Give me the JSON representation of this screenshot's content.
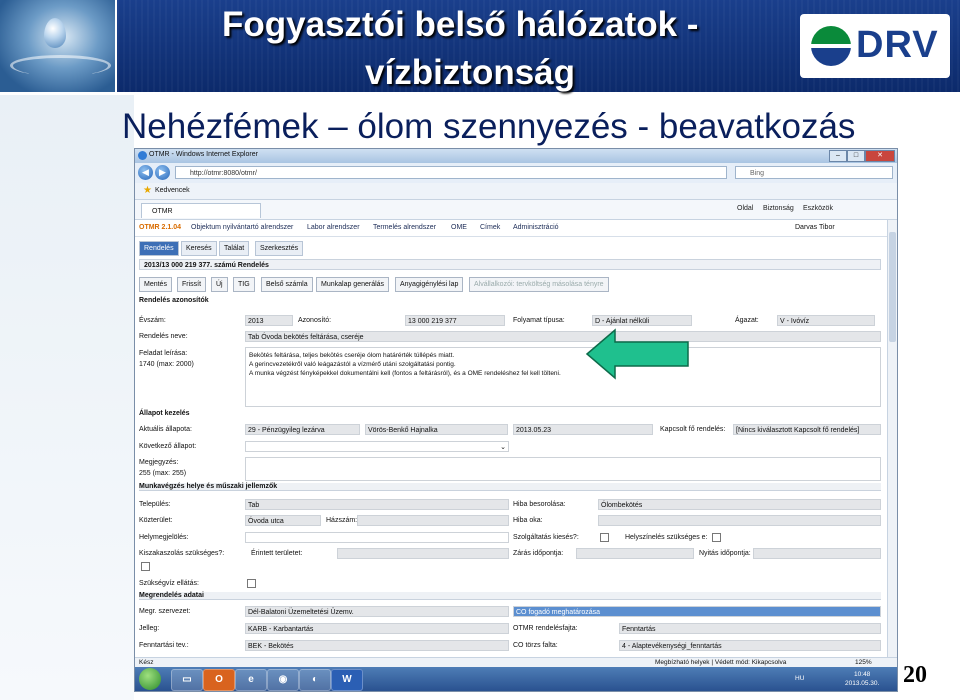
{
  "slide": {
    "title_line1": "Fogyasztói belső hálózatok -",
    "title_line2": "vízbiztonság",
    "subtitle": "Nehézfémek – ólom szennyezés - beavatkozás",
    "logo_text": "DRV",
    "page_number": "20",
    "colors": {
      "title_bg": "#0c2a6b",
      "logo_blue": "#1a3f8c",
      "logo_green": "#0a8a3a",
      "arrow_green": "#1fc08e"
    }
  },
  "browser": {
    "window_title": "OTMR - Windows Internet Explorer",
    "address": "http://otmr:8080/otmr/",
    "search_placeholder": "Bing",
    "favorites_label": "Kedvencek",
    "tab_label": "OTMR",
    "commands": [
      "Oldal",
      "Biztonság",
      "Eszközök"
    ],
    "status_left": "Kész",
    "status_mid": "Megbízható helyek | Védett mód: Kikapcsolva",
    "zoom": "125%"
  },
  "app": {
    "version": "OTMR 2.1.04",
    "menu": [
      "Objektum nyilvántartó alrendszer",
      "Labor alrendszer",
      "Termelés alrendszer",
      "OME",
      "Címek",
      "Adminisztráció"
    ],
    "user": "Darvas Tibor",
    "subtabs": [
      "Rendelés",
      "Keresés",
      "Találat",
      "Szerkesztés"
    ],
    "breadcrumb": "2013/13 000 219 377. számú Rendelés",
    "toolbar": [
      "Mentés",
      "Frissít",
      "Új",
      "TIG",
      "Belső számla",
      "Munkalap generálás",
      "Anyagigénylési lap",
      "Alvállalkozói: tervköltség másolása tényre"
    ],
    "sec_ids": "Rendelés azonosítók",
    "evszam_label": "Évszám:",
    "evszam": "2013",
    "azonosito_label": "Azonosító:",
    "azonosito": "13 000 219 377",
    "folyamat_label": "Folyamat típusa:",
    "folyamat": "D - Ajánlat nélküli",
    "agazat_label": "Ágazat:",
    "agazat": "V - Ivóvíz",
    "rendeles_neve_label": "Rendelés neve:",
    "rendeles_neve": "Tab Óvoda bekötés feltárása, cseréje",
    "feladat_label": "Feladat leírása:",
    "feladat_max": "1740 (max: 2000)",
    "feladat_text": [
      "Bekötés feltárása, teljes bekötés cseréje ólom határérték túllépés miatt.",
      "A gerincvezetékről való leágazástól a vízmérő utáni szolgáltatási pontig.",
      "A munka végzést fényképekkel dokumentálni kell (fontos a feltárásról), és a OME rendeléshez fel kell tölteni."
    ],
    "sec_allapot": "Állapot kezelés",
    "aktualis_label": "Aktuális állapota:",
    "aktualis": "29 - Pénzügyileg lezárva",
    "szemely": "Vörös-Benkő Hajnalka",
    "datum": "2013.05.23",
    "kapcsolt_label": "Kapcsolt fő rendelés:",
    "kapcsolt": "[Nincs kiválasztott Kapcsolt fő rendelés]",
    "kovetkezo_label": "Következő állapot:",
    "megjegyzes_label": "Megjegyzés:",
    "megjegyzes_max": "255 (max: 255)",
    "sec_munka": "Munkavégzés helye és műszaki jellemzők",
    "telepules_label": "Település:",
    "telepules": "Tab",
    "hiba_besorolas_label": "Hiba besorolása:",
    "hiba_besorolas": "Ólombekötés",
    "kozterulet_label": "Közterület:",
    "kozterulet": "Óvoda utca",
    "hazszam_label": "Házszám:",
    "hiba_oka_label": "Hiba oka:",
    "helymegjeloles_label": "Helymegjelölés:",
    "szolgaltatas_label": "Szolgáltatás kiesés?:",
    "helyszinelés_label": "Helyszínelés szükséges e:",
    "kiszakaszolas_label": "Kiszakaszolás szükséges?:",
    "erintett_label": "Érintett területet:",
    "zaras_label": "Zárás időpontja:",
    "nyitas_label": "Nyitás időpontja:",
    "szuksegviz_label": "Szükségvíz ellátás:",
    "sec_megrendeles": "Megrendelés adatai",
    "megr_szervezet_label": "Megr. szervezet:",
    "megr_szervezet": "Dél-Balatoni Üzemeltetési Üzemv.",
    "co_fogado": "CO fogadó meghatározása",
    "jelleg_label": "Jelleg:",
    "jelleg": "KARB - Karbantartás",
    "otmr_fajta_label": "OTMR rendelésfajta:",
    "otmr_fajta": "Fenntartás",
    "fenntartasi_label": "Fenntartási tev.:",
    "fenntartasi": "BEK - Bekötés",
    "co_torzs_label": "CO törzs falta:",
    "co_torzs": "4 - Alaptevékenységi_fenntartás"
  },
  "taskbar": {
    "lang": "HU",
    "time": "10:48",
    "date": "2013.05.30."
  }
}
